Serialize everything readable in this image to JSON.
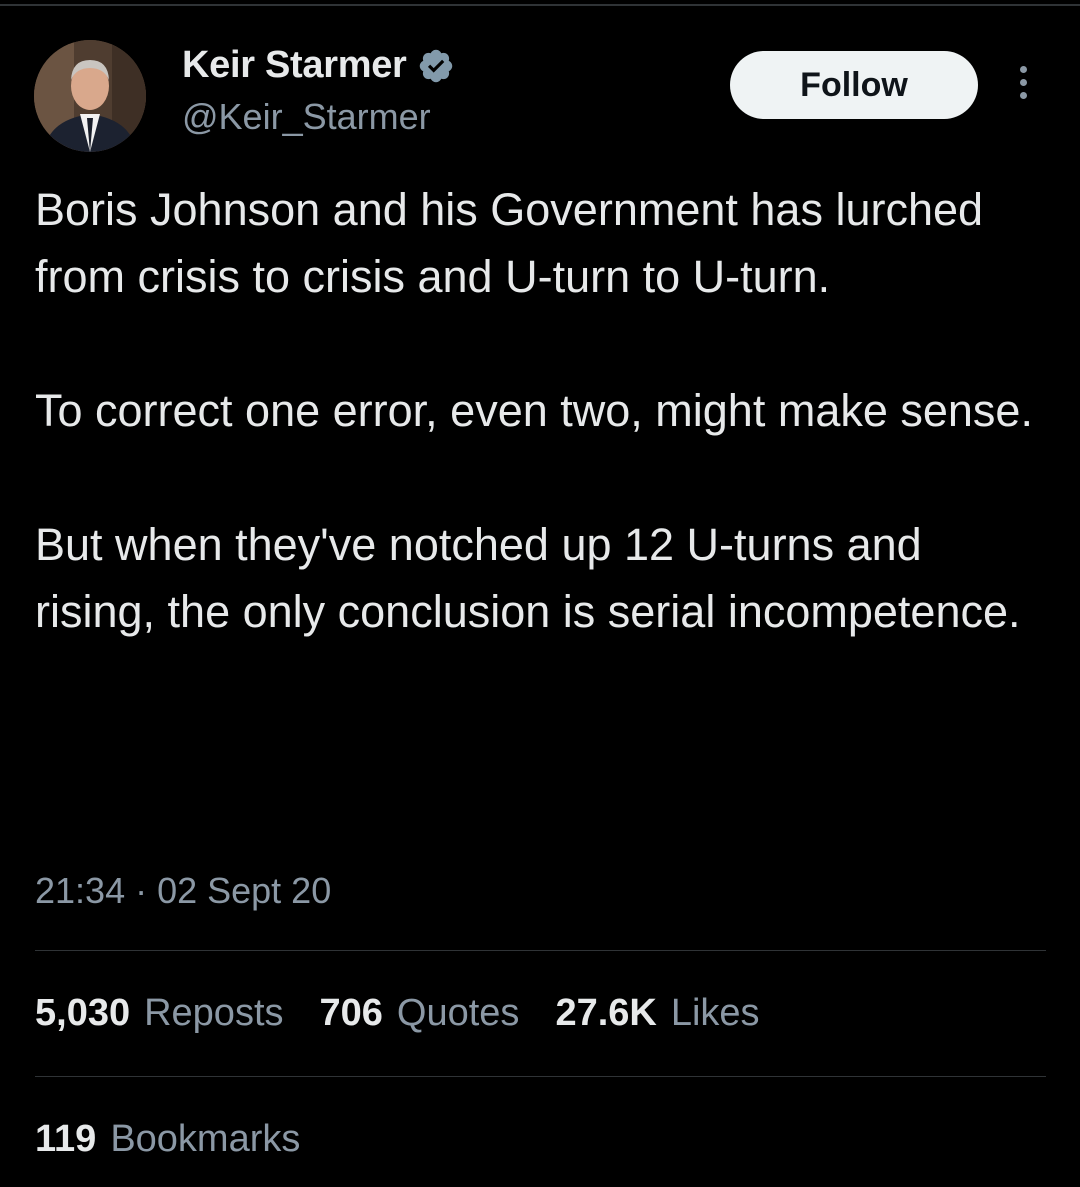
{
  "author": {
    "display_name": "Keir Starmer",
    "handle": "@Keir_Starmer",
    "verified": true
  },
  "actions": {
    "follow_label": "Follow"
  },
  "tweet": {
    "paragraphs": [
      "Boris Johnson and his Government has lurched from crisis to crisis and U-turn to U-turn.",
      "To correct one error, even two, might make sense.",
      "But when they've notched up 12 U-turns and rising, the only conclusion is serial incompetence."
    ],
    "timestamp": "21:34 · 02 Sept 20"
  },
  "stats": {
    "reposts": {
      "count": "5,030",
      "label": "Reposts"
    },
    "quotes": {
      "count": "706",
      "label": "Quotes"
    },
    "likes": {
      "count": "27.6K",
      "label": "Likes"
    },
    "bookmarks": {
      "count": "119",
      "label": "Bookmarks"
    }
  },
  "colors": {
    "background": "#000000",
    "text_primary": "#e7e9ea",
    "text_secondary": "#8b98a5",
    "divider": "#2f3336",
    "verified_badge": "#829aab",
    "follow_button_bg": "#eff3f4"
  },
  "icons": [
    "verified-badge-icon",
    "more-options-icon"
  ]
}
